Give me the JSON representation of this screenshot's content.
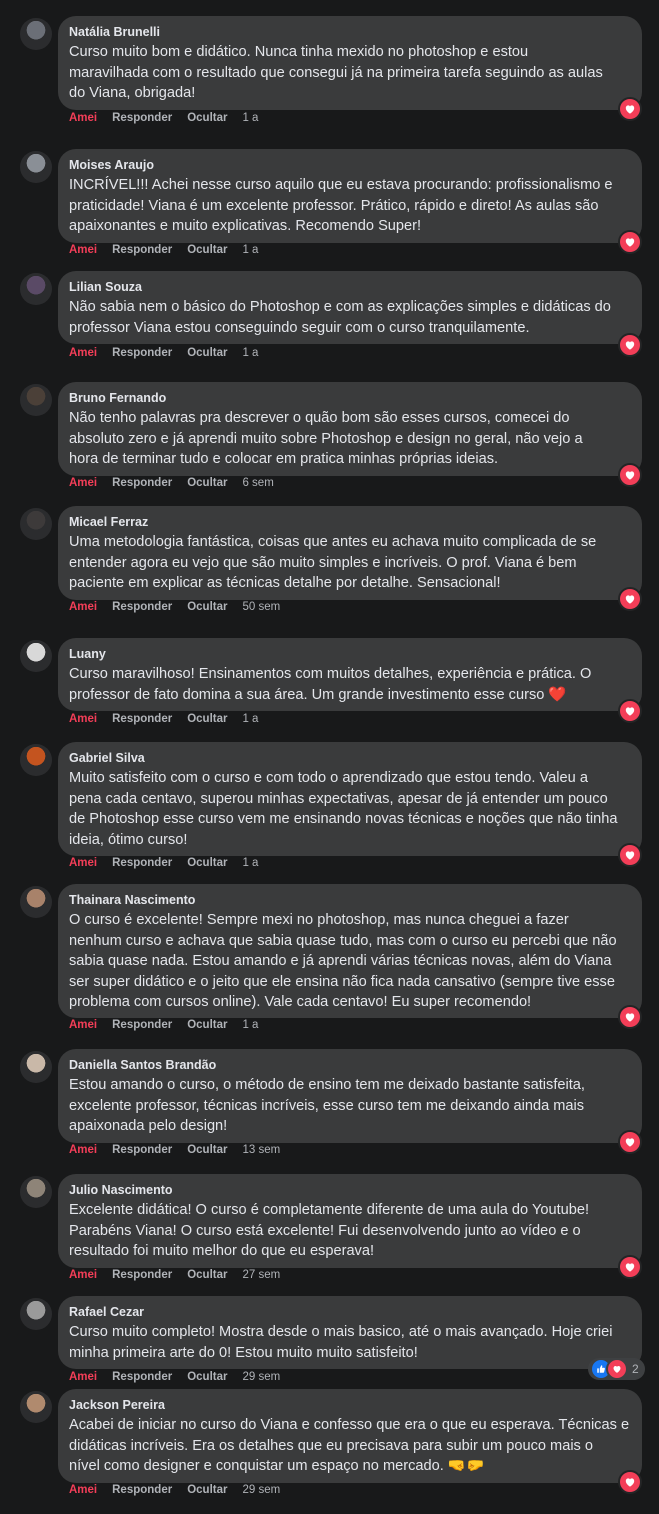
{
  "actions": {
    "love": "Amei",
    "reply": "Responder",
    "hide": "Ocultar"
  },
  "colors": {
    "love": "#f33e58",
    "like": "#1877f2",
    "bubble": "#3a3b3c",
    "background": "#18191a"
  },
  "comments": [
    {
      "name": "Natália Brunelli",
      "text": "Curso muito bom e didático. Nunca tinha mexido no photoshop e estou\nmaravilhada com o resultado que consegui já na primeira tarefa seguindo as aulas\ndo Viana, obrigada!",
      "time": "1 a",
      "avatar_color": "#6b6f77",
      "reaction": "love-icon"
    },
    {
      "name": "Moises Araujo",
      "text": "INCRÍVEL!!! Achei nesse curso aquilo que eu estava procurando: profissionalismo e\npraticidade! Viana é um excelente professor. Prático, rápido e direto! As aulas são\napaixonantes e muito explicativas. Recomendo Super!",
      "time": "1 a",
      "avatar_color": "#8a8f96",
      "reaction": "love-icon"
    },
    {
      "name": "Lilian Souza",
      "text": "Não sabia nem o básico do Photoshop e com as explicações simples e didáticas do\nprofessor Viana estou conseguindo seguir com o curso tranquilamente.",
      "time": "1 a",
      "avatar_color": "#5a4a66",
      "reaction": "love-icon"
    },
    {
      "name": "Bruno Fernando",
      "text": "Não tenho palavras pra descrever o quão bom são esses cursos, comecei do\nabsoluto zero e já aprendi muito sobre Photoshop e design no geral, não vejo a\nhora de terminar tudo e colocar em pratica minhas próprias ideias.",
      "time": "6 sem",
      "avatar_color": "#4b4038",
      "reaction": "love-icon"
    },
    {
      "name": "Micael Ferraz",
      "text": "Uma metodologia fantástica, coisas que antes eu achava muito complicada de se\nentender agora eu vejo que são muito simples e incríveis. O prof. Viana é bem\npaciente em explicar as técnicas detalhe por detalhe. Sensacional!",
      "time": "50 sem",
      "avatar_color": "#3d3a3a",
      "reaction": "love-icon"
    },
    {
      "name": "Luany",
      "text": "Curso maravilhoso! Ensinamentos com muitos detalhes, experiência e prática. O\nprofessor de fato domina a sua área. Um grande investimento esse curso ❤️",
      "time": "1 a",
      "avatar_color": "#d8d8d8",
      "reaction": "love-icon"
    },
    {
      "name": "Gabriel Silva",
      "text": "Muito satisfeito com o curso e com todo o aprendizado que estou tendo. Valeu a\npena cada centavo, superou minhas expectativas, apesar de já entender um pouco\nde Photoshop esse curso vem me ensinando novas técnicas e noções que não tinha\nideia, ótimo curso!",
      "time": "1 a",
      "avatar_color": "#c4541f",
      "reaction": "love-icon"
    },
    {
      "name": "Thainara Nascimento",
      "text": "O curso é excelente! Sempre mexi no photoshop, mas nunca cheguei a fazer\nnenhum curso e achava que sabia quase tudo, mas com o curso eu percebi que não\nsabia quase nada. Estou amando e já aprendi várias técnicas novas, além do Viana\nser super didático e o jeito que ele ensina não fica nada cansativo (sempre tive esse\nproblema com cursos online). Vale cada centavo! Eu super recomendo!",
      "time": "1 a",
      "avatar_color": "#a8826a",
      "reaction": "love-icon"
    },
    {
      "name": "Daniella Santos Brandão",
      "text": "Estou amando o curso, o método de ensino tem me deixado bastante satisfeita,\nexcelente professor, técnicas incríveis, esse curso tem me deixando ainda mais\napaixonada pelo design!",
      "time": "13 sem",
      "avatar_color": "#c9b8a8",
      "reaction": "love-icon"
    },
    {
      "name": "Julio Nascimento",
      "text": "Excelente didática! O curso é completamente diferente de uma aula do Youtube!\nParabéns Viana! O curso está excelente! Fui desenvolvendo junto ao vídeo e o\nresultado foi muito melhor do que eu esperava!",
      "time": "27 sem",
      "avatar_color": "#8e8478",
      "reaction": "love-icon"
    },
    {
      "name": "Rafael Cezar",
      "text": "Curso muito completo! Mostra desde o mais basico, até o mais avançado. Hoje criei\nminha primeira arte do 0! Estou muito muito satisfeito!",
      "time": "29 sem",
      "avatar_color": "#9a9a9a",
      "reaction": "like-love-count",
      "reaction_count": "2"
    },
    {
      "name": "Jackson Pereira",
      "text": "Acabei de iniciar no curso do Viana e confesso que era o que eu esperava. Técnicas e\ndidáticas incríveis. Era os detalhes que eu precisava para subir um pouco mais o\nnível como designer e conquistar um espaço no mercado. 🤜🤛",
      "time": "29 sem",
      "avatar_color": "#b08a6e",
      "reaction": "love-icon"
    }
  ]
}
